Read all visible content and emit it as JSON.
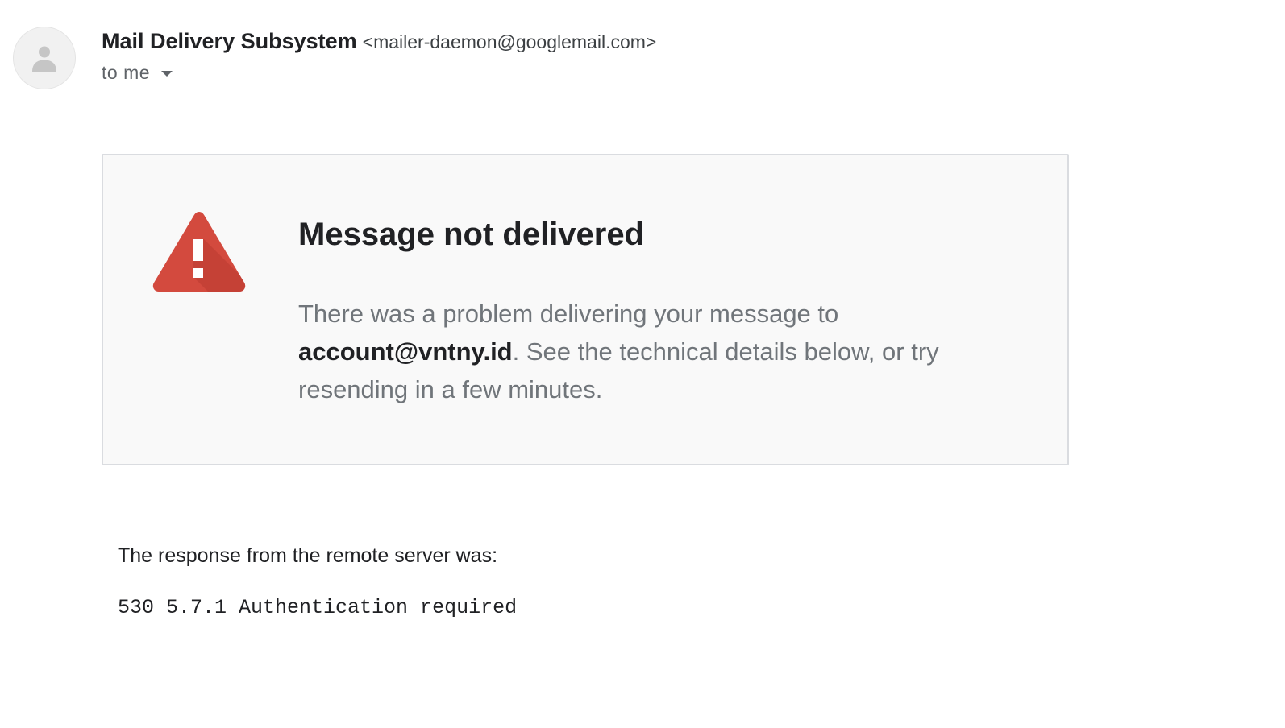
{
  "sender": {
    "name": "Mail Delivery Subsystem",
    "email": "<mailer-daemon@googlemail.com>",
    "avatar_icon": "person-icon"
  },
  "recipient": {
    "label": "to me",
    "dropdown_icon": "chevron-down-icon"
  },
  "notice": {
    "icon": "warning-icon",
    "icon_color": "#d34a3e",
    "title": "Message not delivered",
    "body_before": "There was a problem delivering your message to ",
    "recipient_address": "account@vntny.id",
    "body_after": ". See the technical details below, or try resending in a few minutes."
  },
  "response": {
    "label": "The response from the remote server was:",
    "code": "530 5.7.1 Authentication required"
  }
}
